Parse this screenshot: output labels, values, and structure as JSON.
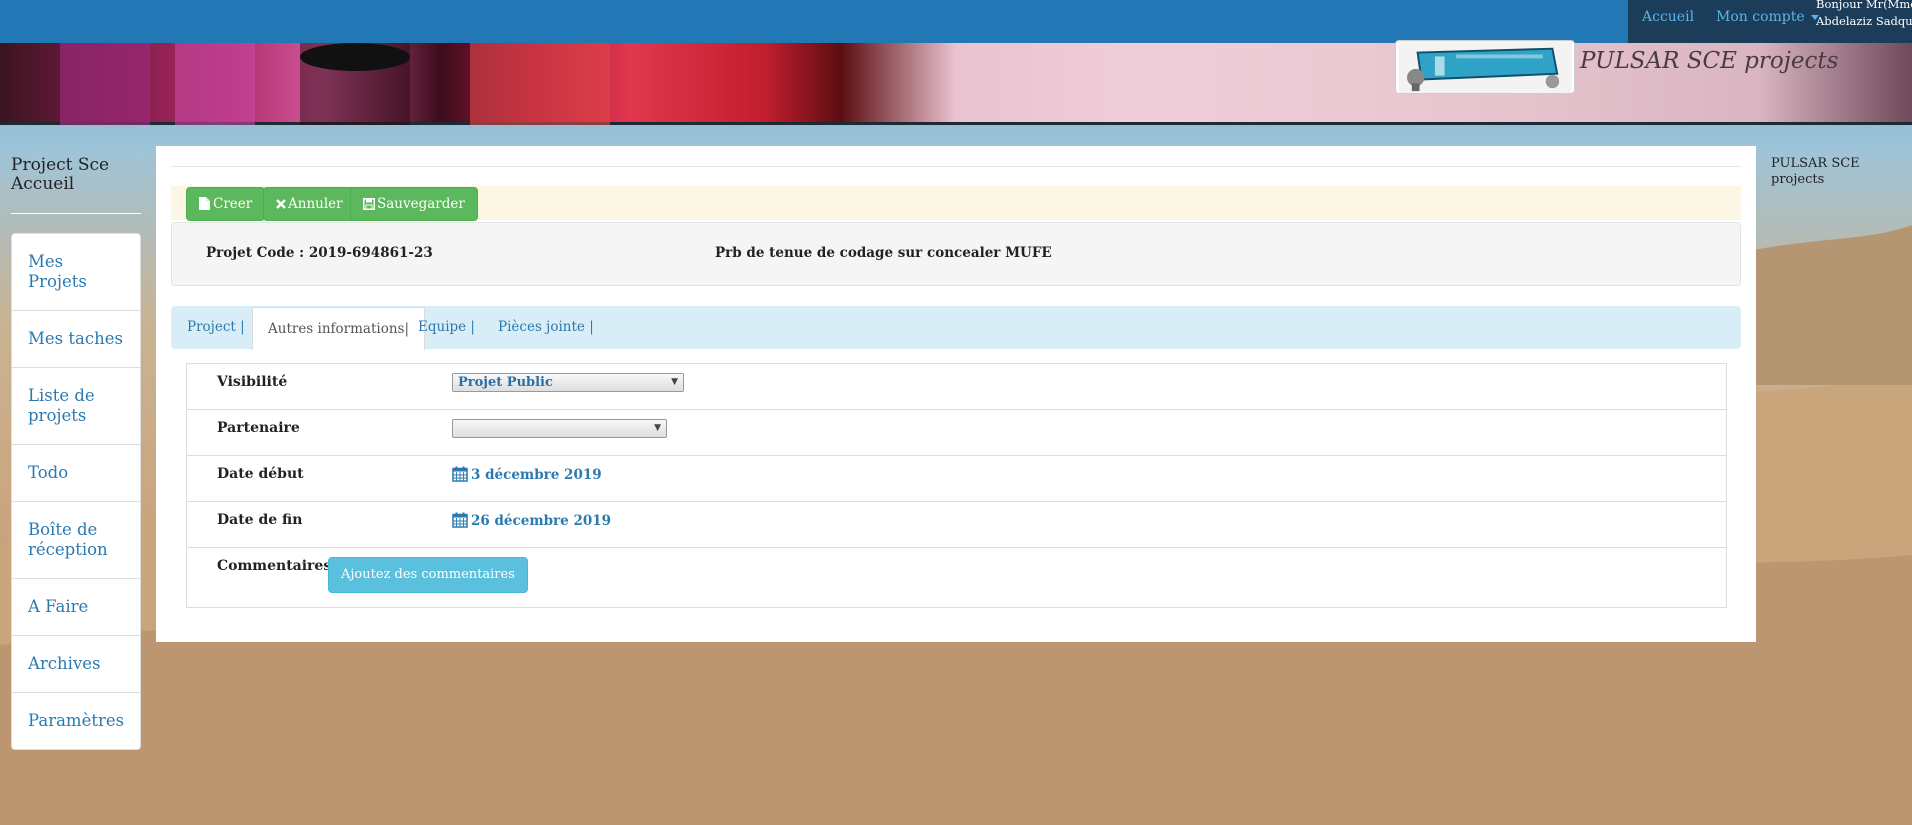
{
  "nav": {
    "accueil": "Accueil",
    "account": "Mon compte",
    "greeting_line1": "Bonjour Mr(Mme)",
    "greeting_line2": "Abdelaziz Sadquaoui"
  },
  "brand": "PULSAR SCE projects",
  "sidebar": {
    "title_line1": "Project Sce",
    "title_line2": "Accueil",
    "items": [
      {
        "label": "Mes Projets"
      },
      {
        "label": "Mes taches"
      },
      {
        "label": "Liste de projets"
      },
      {
        "label": "Todo"
      },
      {
        "label": "Boîte de réception"
      },
      {
        "label": "A Faire"
      },
      {
        "label": "Archives"
      },
      {
        "label": "Paramètres"
      }
    ]
  },
  "toolbar": {
    "create": "Creer",
    "cancel": "Annuler",
    "save": "Sauvegarder"
  },
  "info": {
    "code": "Projet Code : 2019-694861-23",
    "description": "Prb de tenue de codage sur concealer MUFE"
  },
  "tabs": [
    {
      "label": "Project |"
    },
    {
      "label": "Autres informations|",
      "active": true
    },
    {
      "label": "Equipe |"
    },
    {
      "label": "Pièces jointe |"
    }
  ],
  "form": {
    "visibility_label": "Visibilité",
    "visibility_value": "Projet Public",
    "partner_label": "Partenaire",
    "partner_value": "",
    "start_label": "Date début",
    "start_value": "3 décembre 2019",
    "end_label": "Date de fin",
    "end_value": "26 décembre 2019",
    "comments_label": "Commentaires",
    "comments_button": "Ajoutez des commentaires"
  },
  "right_panel": {
    "line1": "PULSAR SCE",
    "line2": "projects"
  },
  "colors": {
    "navbar": "#2178b4",
    "accent": "#2a7ab0",
    "success": "#5cb85c",
    "info": "#5bc0de"
  }
}
